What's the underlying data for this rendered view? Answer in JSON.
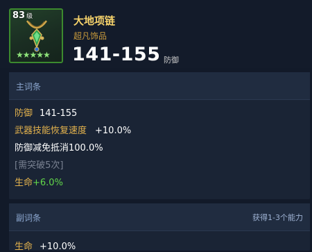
{
  "item": {
    "level": "83",
    "level_unit": "级",
    "name": "大地项链",
    "type": "超凡饰品",
    "main_value": "141-155",
    "main_label": "防御",
    "stars": "★★★★★"
  },
  "main_stats": {
    "title": "主词条",
    "rows": [
      {
        "label": "防御",
        "value": "141-155"
      },
      {
        "label": "武器技能恢复速度",
        "value": "+10.0%"
      },
      {
        "label": "防御减免抵消100.0%"
      },
      {
        "label": "[需突破5次]"
      },
      {
        "label": "生命",
        "value": "+6.0%"
      }
    ]
  },
  "sub_stats": {
    "title": "副词条",
    "note": "获得1-3个能力",
    "rows": [
      {
        "label": "生命",
        "value": "+10.0%"
      }
    ]
  },
  "colors": {
    "stat_label": "#e3b24d",
    "bonus_green": "#62d84a",
    "item_name": "#f5d26b",
    "rarity_text": "#c89a3c"
  },
  "icons": {
    "item": "necklace-icon",
    "rating": "star-icon"
  }
}
